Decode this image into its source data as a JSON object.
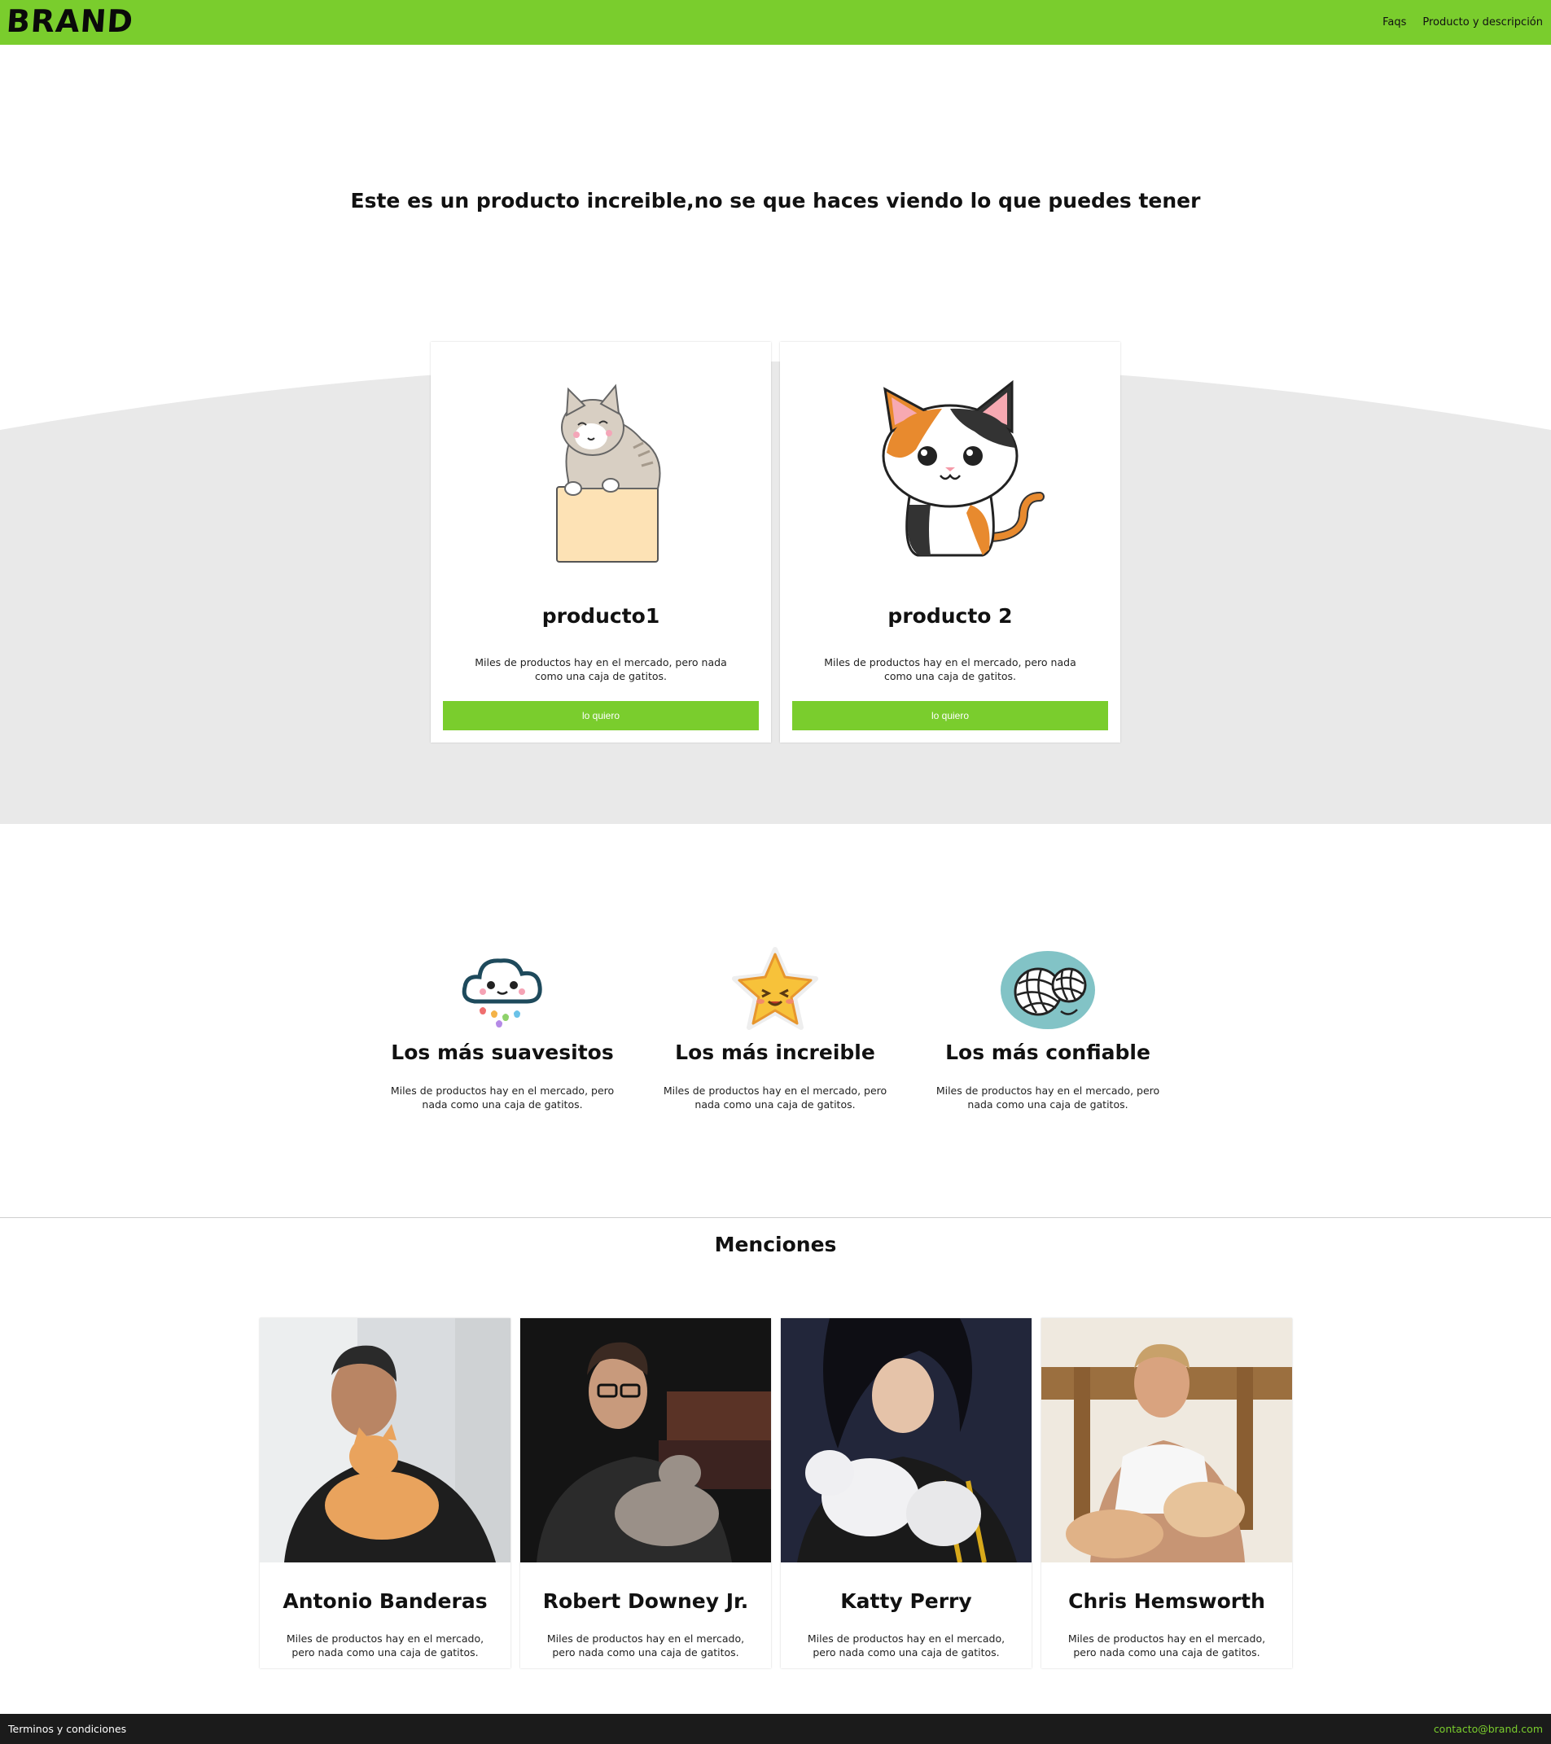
{
  "header": {
    "brand": "BRAND",
    "nav": [
      "Faqs",
      "Producto y descripción"
    ],
    "bar_color": "#7acd2d"
  },
  "hero": {
    "title": "Este es un producto increible,no se que haces viendo lo que puedes tener"
  },
  "products": [
    {
      "title": "producto1",
      "description": "Miles de productos hay en el mercado, pero nada como una caja de gatitos.",
      "button": "lo quiero",
      "image": "cat-in-box-illustration"
    },
    {
      "title": "producto 2",
      "description": "Miles de productos hay en el mercado, pero nada como una caja de gatitos.",
      "button": "lo quiero",
      "image": "calico-cat-illustration"
    }
  ],
  "features": [
    {
      "icon": "rainbow-cloud-icon",
      "title": "Los más suavesitos",
      "description": "Miles de productos hay en el mercado, pero nada como una caja de gatitos."
    },
    {
      "icon": "smiling-star-icon",
      "title": "Los más increible",
      "description": "Miles de productos hay en el mercado, pero nada como una caja de gatitos."
    },
    {
      "icon": "yarn-balls-icon",
      "title": "Los más confiable",
      "description": "Miles de productos hay en el mercado, pero nada como una caja de gatitos."
    }
  ],
  "mentions": {
    "title": "Menciones",
    "items": [
      {
        "name": "Antonio Banderas",
        "description": "Miles de productos hay en el mercado, pero nada como una caja de gatitos."
      },
      {
        "name": "Robert Downey Jr.",
        "description": "Miles de productos hay en el mercado, pero nada como una caja de gatitos."
      },
      {
        "name": "Katty Perry",
        "description": "Miles de productos hay en el mercado, pero nada como una caja de gatitos."
      },
      {
        "name": "Chris Hemsworth",
        "description": "Miles de productos hay en el mercado, pero nada como una caja de gatitos."
      }
    ]
  },
  "footer": {
    "terms": "Terminos y condiciones",
    "email": "contacto@brand.com"
  }
}
